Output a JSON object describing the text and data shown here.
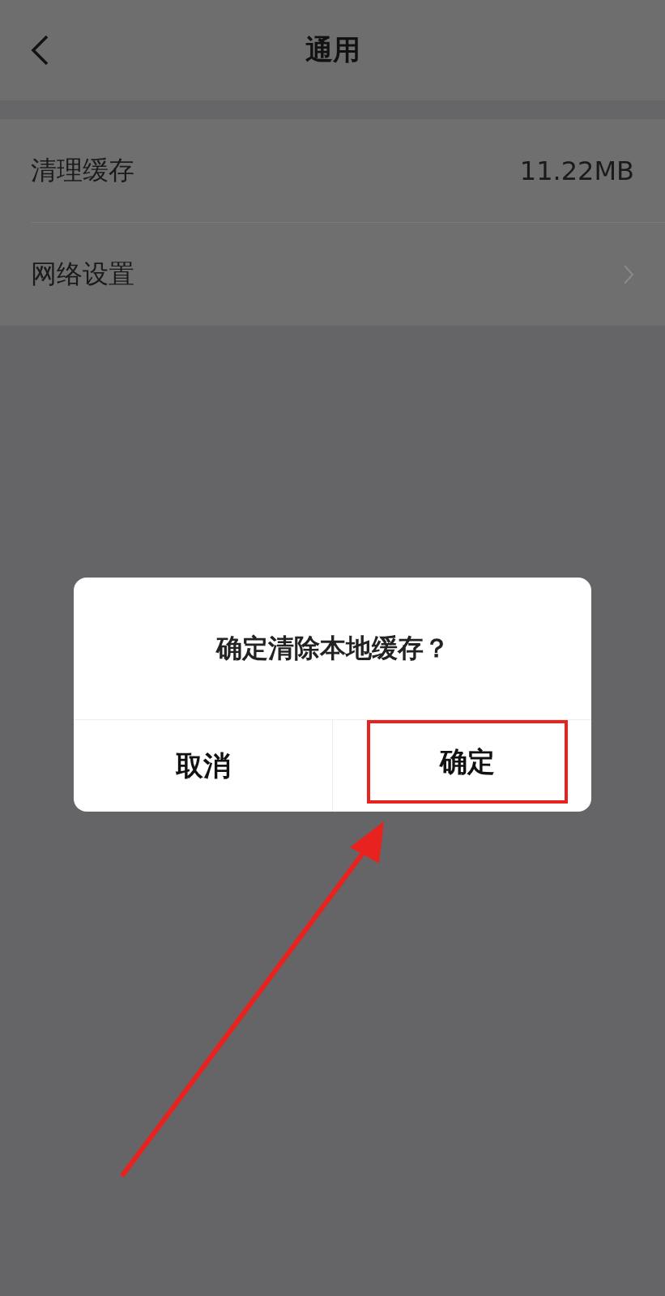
{
  "header": {
    "title": "通用"
  },
  "settings": [
    {
      "kind": "value",
      "label": "清理缓存",
      "value": "11.22MB"
    },
    {
      "kind": "link",
      "label": "网络设置"
    }
  ],
  "dialog": {
    "message": "确定清除本地缓存？",
    "buttons": [
      {
        "label": "取消",
        "annotated": false
      },
      {
        "label": "确定",
        "annotated": true
      }
    ]
  }
}
